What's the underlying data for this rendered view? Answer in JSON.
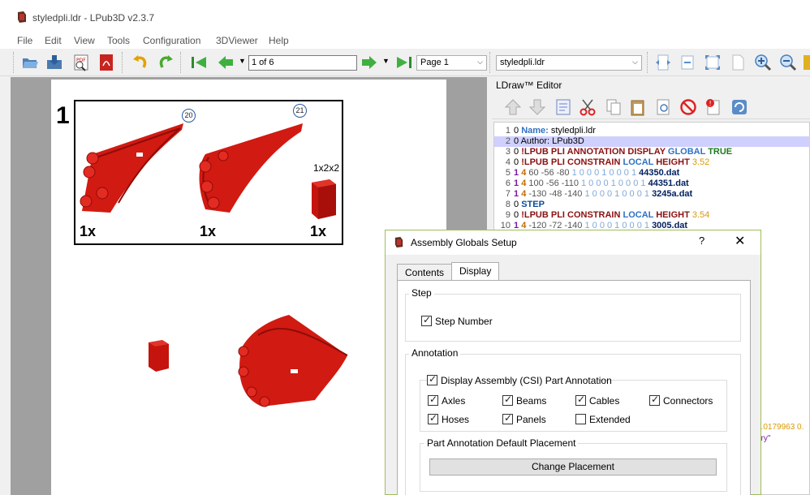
{
  "window": {
    "title": "styledpli.ldr - LPub3D v2.3.7"
  },
  "menu": [
    "File",
    "Edit",
    "View",
    "Tools",
    "Configuration",
    "3DViewer",
    "Help"
  ],
  "toolbar": {
    "page_field": "1 of 6",
    "page_combo": "Page 1",
    "file_combo": "styledpli.ldr"
  },
  "page": {
    "step_number": "1",
    "pli": {
      "items": [
        {
          "qty": "1x",
          "annotation": "20"
        },
        {
          "qty": "1x",
          "annotation": "21"
        },
        {
          "qty": "1x",
          "size": "1x2x2"
        }
      ]
    }
  },
  "editor": {
    "title": "LDraw™ Editor",
    "lines": [
      {
        "n": "1",
        "parts": [
          [
            "c-zero",
            "0 "
          ],
          [
            "c-blue",
            "Name: "
          ],
          [
            "c-zero",
            "styledpli.ldr"
          ]
        ]
      },
      {
        "n": "2",
        "hl": true,
        "parts": [
          [
            "c-zero",
            "0 "
          ],
          [
            "c-zero",
            "Author: "
          ],
          [
            "c-zero",
            "LPub3D"
          ]
        ]
      },
      {
        "n": "3",
        "parts": [
          [
            "c-zero",
            "0 "
          ],
          [
            "c-key",
            "!LPUB "
          ],
          [
            "c-key",
            "PLI ANNOTATION DISPLAY "
          ],
          [
            "c-blue",
            "GLOBAL "
          ],
          [
            "c-green",
            "TRUE"
          ]
        ]
      },
      {
        "n": "4",
        "parts": [
          [
            "c-zero",
            "0 "
          ],
          [
            "c-key",
            "!LPUB "
          ],
          [
            "c-key",
            "PLI CONSTRAIN "
          ],
          [
            "c-blue",
            "LOCAL "
          ],
          [
            "c-key",
            "HEIGHT "
          ],
          [
            "c-orange",
            "3.52"
          ]
        ]
      },
      {
        "n": "5",
        "parts": [
          [
            "c-type",
            "1 "
          ],
          [
            "c-color",
            "4 "
          ],
          [
            "c-coord",
            "60 -56 -80 "
          ],
          [
            "c-matrix",
            "1 0 0 0 1 0 0 0 1 "
          ],
          [
            "c-file",
            "44350.dat"
          ]
        ]
      },
      {
        "n": "6",
        "parts": [
          [
            "c-type",
            "1 "
          ],
          [
            "c-color",
            "4 "
          ],
          [
            "c-coord",
            "100 -56 -110 "
          ],
          [
            "c-matrix",
            "1 0 0 0 1 0 0 0 1 "
          ],
          [
            "c-file",
            "44351.dat"
          ]
        ]
      },
      {
        "n": "7",
        "parts": [
          [
            "c-type",
            "1 "
          ],
          [
            "c-color",
            "4 "
          ],
          [
            "c-coord",
            "-130 -48 -140 "
          ],
          [
            "c-matrix",
            "1 0 0 0 1 0 0 0 1 "
          ],
          [
            "c-file",
            "3245a.dat"
          ]
        ]
      },
      {
        "n": "8",
        "parts": [
          [
            "c-zero",
            "0 "
          ],
          [
            "c-step",
            "STEP"
          ]
        ]
      },
      {
        "n": "9",
        "parts": [
          [
            "c-zero",
            "0 "
          ],
          [
            "c-key",
            "!LPUB "
          ],
          [
            "c-key",
            "PLI CONSTRAIN "
          ],
          [
            "c-blue",
            "LOCAL "
          ],
          [
            "c-key",
            "HEIGHT "
          ],
          [
            "c-orange",
            "3.54"
          ]
        ]
      },
      {
        "n": "10",
        "parts": [
          [
            "c-type",
            "1 "
          ],
          [
            "c-color",
            "4 "
          ],
          [
            "c-coord",
            "-120 -72 -140 "
          ],
          [
            "c-matrix",
            "1 0 0 0 1 0 0 0 1 "
          ],
          [
            "c-file",
            "3005.dat"
          ]
        ]
      }
    ],
    "fragment_1": "0.0179963 0.",
    "fragment_2": "ory\""
  },
  "dialog": {
    "title": "Assembly Globals Setup",
    "help": "?",
    "close": "✕",
    "tabs": [
      "Contents",
      "Display"
    ],
    "active_tab": "Display",
    "step_group": "Step",
    "step_number_label": "Step Number",
    "annotation_group": "Annotation",
    "display_annotation_label": "Display Assembly (CSI) Part Annotation",
    "checks": [
      {
        "label": "Axles",
        "checked": true
      },
      {
        "label": "Beams",
        "checked": true
      },
      {
        "label": "Cables",
        "checked": true
      },
      {
        "label": "Connectors",
        "checked": true
      },
      {
        "label": "Hoses",
        "checked": true
      },
      {
        "label": "Panels",
        "checked": true
      },
      {
        "label": "Extended",
        "checked": false
      }
    ],
    "placement_group": "Part Annotation Default Placement",
    "change_placement": "Change Placement"
  }
}
